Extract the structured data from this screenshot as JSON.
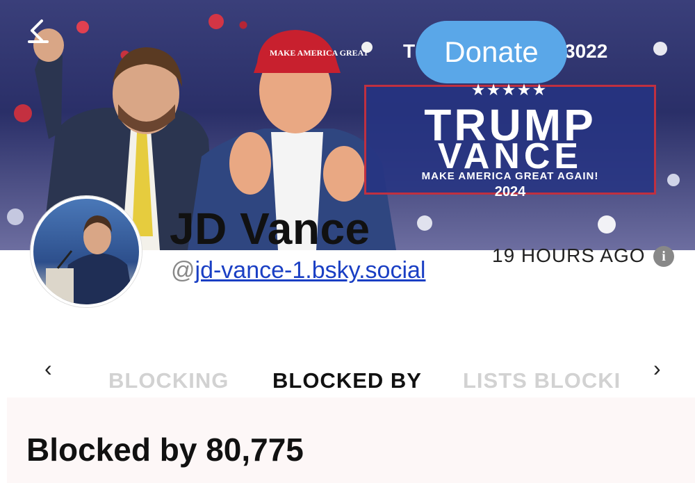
{
  "banner": {
    "top_text_left": "T",
    "top_text_right": "3022",
    "sign_title_1": "TRUMP",
    "sign_title_2": "VANCE",
    "sign_slogan": "MAKE AMERICA GREAT AGAIN!",
    "sign_year": "2024",
    "sign_stars": "★★★★★",
    "hat_text": "MAKE AMERICA GREAT"
  },
  "back_icon": "chevron-left-icon",
  "donate_label": "Donate",
  "profile": {
    "name": "JD Vance",
    "handle_prefix": "@",
    "handle": "jd-vance-1.bsky.social",
    "time": "19 HOURS AGO",
    "info_glyph": "i"
  },
  "tabs": {
    "prev_arrow": "‹",
    "next_arrow": "›",
    "items": [
      {
        "label": "BLOCKING",
        "active": false
      },
      {
        "label": "BLOCKED BY",
        "active": true
      },
      {
        "label": "LISTS BLOCKI",
        "active": false
      }
    ]
  },
  "summary": {
    "text": "Blocked by 80,775"
  },
  "colors": {
    "donate": "#5aa7e8",
    "link": "#1a3fc4",
    "sign_border": "#c03040"
  }
}
